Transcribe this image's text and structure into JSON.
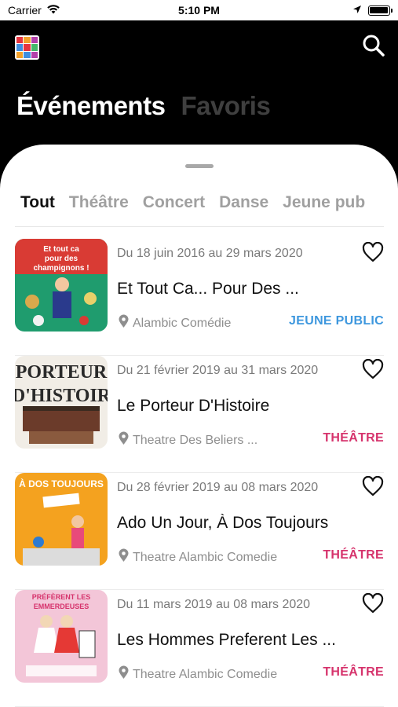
{
  "status_bar": {
    "carrier": "Carrier",
    "time": "5:10 PM",
    "icons": [
      "wifi-icon",
      "location-arrow-icon",
      "battery-icon"
    ]
  },
  "header": {
    "logo_icon": "app-grid-logo",
    "search_icon": "search-icon",
    "tabs": [
      {
        "label": "Événements",
        "active": true
      },
      {
        "label": "Favoris",
        "active": false
      }
    ]
  },
  "filters": {
    "tabs": [
      "Tout",
      "Théâtre",
      "Concert",
      "Danse",
      "Jeune pub"
    ],
    "active_index": 0
  },
  "colors": {
    "jeune_public": "#3d97de",
    "theatre": "#d6336c"
  },
  "events": [
    {
      "date": "Du 18 juin 2016 au 29 mars 2020",
      "title": "Et Tout Ca... Pour Des ...",
      "venue": "Alambic Comédie",
      "category": "JEUNE PUBLIC",
      "category_color": "#3d97de",
      "poster_text": "Et tout ca pour des champignons !",
      "favorite": false
    },
    {
      "date": "Du 21 février 2019 au 31 mars 2020",
      "title": "Le Porteur D'Histoire",
      "venue": "Theatre Des Beliers ...",
      "category": "THÉÂTRE",
      "category_color": "#d6336c",
      "poster_text": "PORTEUR D'HISTOIR",
      "favorite": false
    },
    {
      "date": "Du 28 février 2019 au 08 mars 2020",
      "title": "Ado Un Jour, À Dos Toujours",
      "venue": "Theatre Alambic Comedie",
      "category": "THÉÂTRE",
      "category_color": "#d6336c",
      "poster_text": "À DOS TOUJOURS",
      "favorite": false
    },
    {
      "date": "Du 11 mars 2019 au 08 mars 2020",
      "title": "Les Hommes Preferent Les ...",
      "venue": "Theatre Alambic Comedie",
      "category": "THÉÂTRE",
      "category_color": "#d6336c",
      "poster_text": "PRÉFÈRENT LES EMMERDEUSES",
      "favorite": false
    }
  ]
}
